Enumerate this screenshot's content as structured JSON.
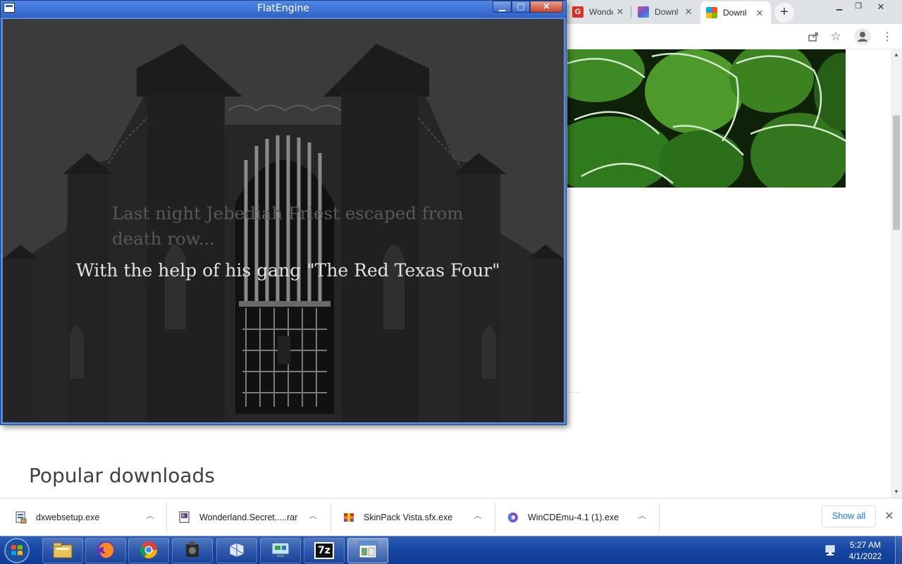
{
  "chrome": {
    "tabs": [
      {
        "title": "Wonderland",
        "favicon": "g-red-icon"
      },
      {
        "title": "Download",
        "favicon": "gradient-icon"
      },
      {
        "title": "Download",
        "favicon": "windows-icon",
        "active": true
      }
    ],
    "new_tab_label": "+",
    "page": {
      "heading": "Popular downloads"
    }
  },
  "downloads": {
    "items": [
      {
        "filename": "dxwebsetup.exe",
        "icon": "installer-icon"
      },
      {
        "filename": "Wonderland.Secret.....rar",
        "icon": "rar-archive-icon"
      },
      {
        "filename": "SkinPack Vista.sfx.exe",
        "icon": "package-icon"
      },
      {
        "filename": "WinCDEmu-4.1 (1).exe",
        "icon": "disc-emulator-icon"
      }
    ],
    "show_all_label": "Show all"
  },
  "flatengine": {
    "window_title": "FlatEngine",
    "story_line_1": "Last night Jebediah Priest escaped from death row...",
    "story_line_2": "With the help of his gang \"The Red Texas Four\""
  },
  "taskbar": {
    "apps": [
      {
        "name": "file-explorer-icon"
      },
      {
        "name": "firefox-icon"
      },
      {
        "name": "chrome-icon"
      },
      {
        "name": "media-icon"
      },
      {
        "name": "app-icon"
      },
      {
        "name": "network-settings-icon"
      },
      {
        "name": "7zip-icon",
        "label": "7z"
      },
      {
        "name": "flatengine-icon",
        "active": true
      }
    ],
    "clock_time": "5:27 AM",
    "clock_date": "4/1/2022"
  },
  "colors": {
    "chrome_tabstrip": "#dee1e6",
    "accent_blue": "#1a73e8",
    "taskbar": "#1746a2",
    "flat_titlebar": "#2f62c6"
  }
}
